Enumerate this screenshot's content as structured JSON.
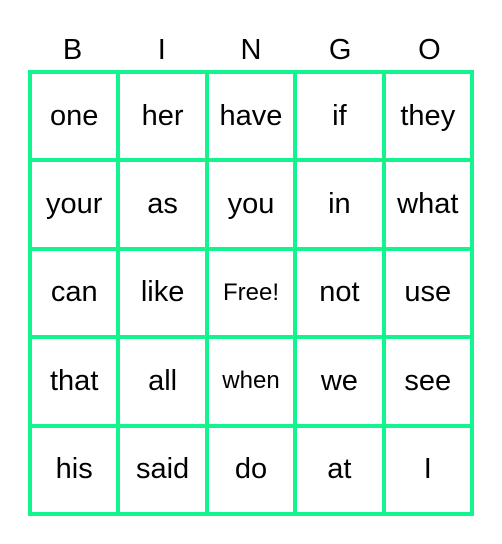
{
  "header": [
    "B",
    "I",
    "N",
    "G",
    "O"
  ],
  "border_color": "#12F58E",
  "rows": [
    [
      "one",
      "her",
      "have",
      "if",
      "they"
    ],
    [
      "your",
      "as",
      "you",
      "in",
      "what"
    ],
    [
      "can",
      "like",
      "Free!",
      "not",
      "use"
    ],
    [
      "that",
      "all",
      "when",
      "we",
      "see"
    ],
    [
      "his",
      "said",
      "do",
      "at",
      "I"
    ]
  ]
}
